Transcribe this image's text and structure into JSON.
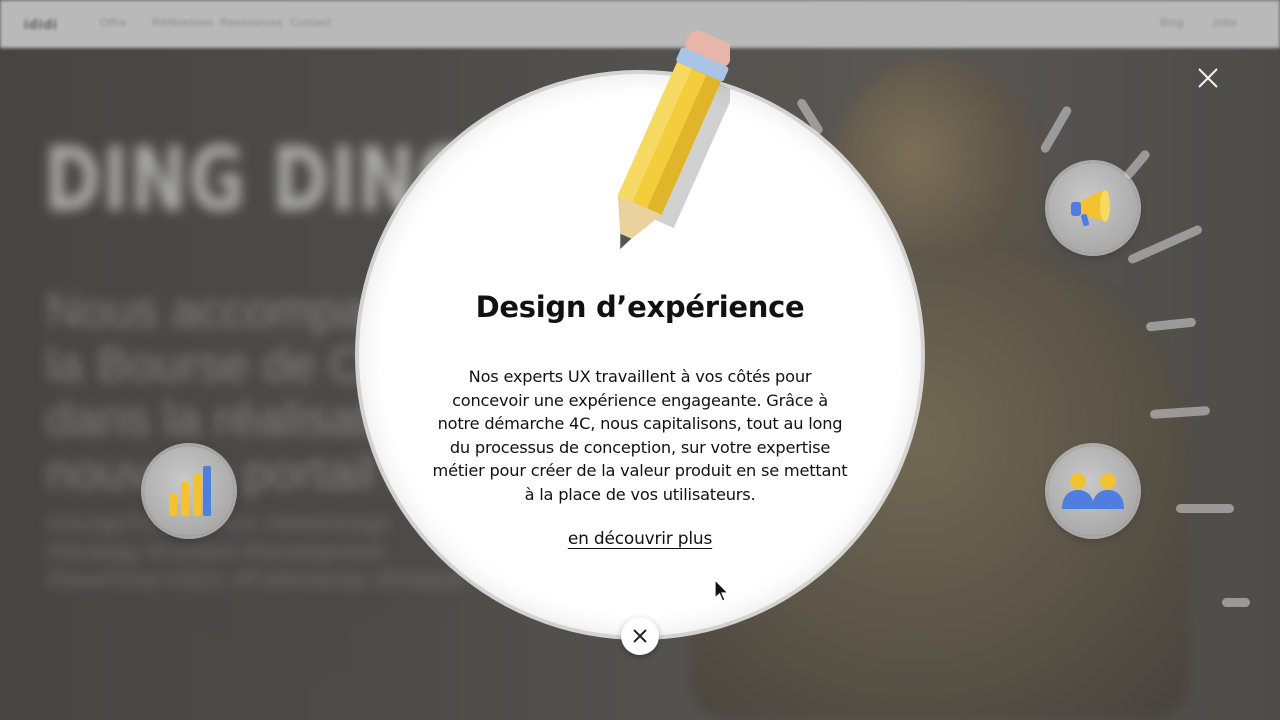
{
  "nav": {
    "logo": "ididi",
    "links": [
      "Offre",
      "Références",
      "Ressources",
      "Contact"
    ],
    "right": [
      "Blog",
      "Jobs"
    ]
  },
  "background": {
    "title": "DING DING D",
    "lead": [
      "Nous accompag",
      "la Bourse de Ca",
      "dans la réalisatio",
      "nouveau portail w"
    ],
    "meta": [
      "#DesignThinking #UX #WebDesign",
      "#Strategy #Content #Development",
      "#NewPortal #2021 #PublicSector #Finance"
    ]
  },
  "modal": {
    "title": "Design d’expérience",
    "body": "Nos experts UX travaillent à vos côtés pour concevoir une expérience engageante. Grâce à notre démarche 4C, nous capitalisons, tout au long du processus de conception, sur votre expertise métier pour créer de la valeur produit en se mettant à la place de vos utilisateurs.",
    "link": "en découvrir plus"
  },
  "icons": {
    "left_bubble": "bar-chart-icon",
    "top_right_bubble": "megaphone-icon",
    "bottom_right_bubble": "users-icon",
    "modal_illustration": "pencil-icon"
  },
  "colors": {
    "modal_bg": "#ffffff",
    "text": "#111111",
    "pencil_yellow": "#f3cd3c",
    "accent_blue": "#4f7de0"
  }
}
